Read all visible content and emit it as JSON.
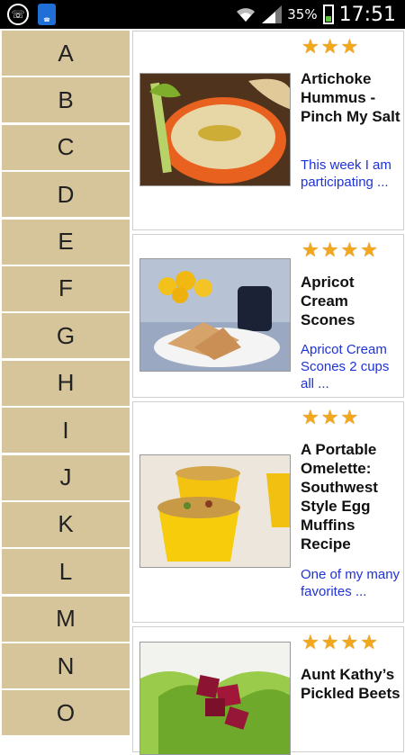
{
  "status_bar": {
    "battery_percent": "35%",
    "time": "17:51",
    "icons": [
      "whatsapp-icon",
      "app-notification-icon",
      "wifi-icon",
      "signal-icon",
      "battery-icon"
    ]
  },
  "alphabet": [
    "A",
    "B",
    "C",
    "D",
    "E",
    "F",
    "G",
    "H",
    "I",
    "J",
    "K",
    "L",
    "M",
    "N",
    "O"
  ],
  "recipes": [
    {
      "title": "Artichoke Hummus - Pinch My Salt",
      "snippet": "This week I am participating ...",
      "rating": 3,
      "image": "hummus-photo"
    },
    {
      "title": "Apricot Cream Scones",
      "snippet": "Apricot Cream Scones 2 cups all ...",
      "rating": 4,
      "image": "scones-photo"
    },
    {
      "title": "A Portable Omelette: Southwest Style Egg Muffins Recipe",
      "snippet": "One of my many favorites ...",
      "rating": 3,
      "image": "egg-muffins-photo"
    },
    {
      "title": "Aunt Kathy’s Pickled Beets",
      "snippet": "",
      "rating": 4,
      "image": "pickled-beets-photo"
    }
  ],
  "colors": {
    "alpha_bg": "#d6c59b",
    "link": "#1f32d6",
    "star": "#f3a71a"
  }
}
